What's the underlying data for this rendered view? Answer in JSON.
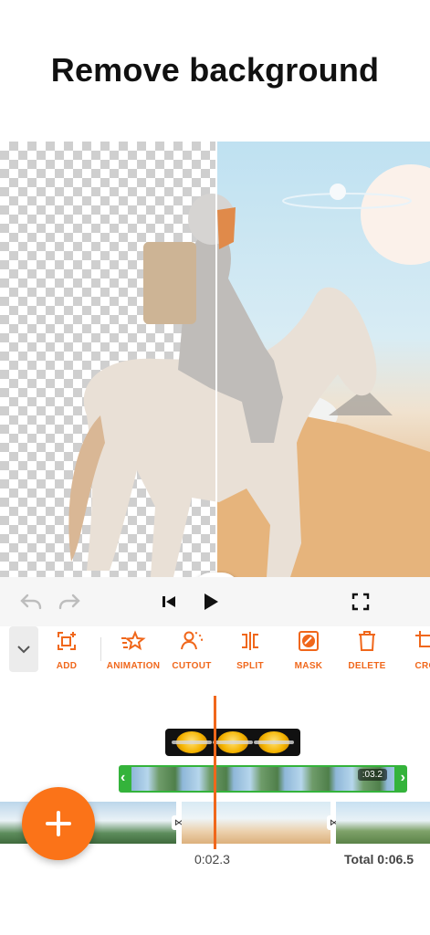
{
  "headline": "Remove background",
  "colors": {
    "accent": "#f0671b",
    "fab": "#fb7318",
    "overlay_track": "#34b33b"
  },
  "preview": {
    "handle_icon": "split-drag-icon",
    "cutout_button_icon": "person-cutout-icon"
  },
  "controls": {
    "undo_icon": "undo-icon",
    "redo_icon": "redo-icon",
    "skip_start_icon": "skip-to-start-icon",
    "play_icon": "play-icon",
    "fullscreen_icon": "fullscreen-icon"
  },
  "toolbar": {
    "collapse_icon": "chevron-down-icon",
    "items": [
      {
        "label": "ADD",
        "icon": "add-layer-icon"
      },
      {
        "label": "ANIMATION",
        "icon": "animation-star-icon"
      },
      {
        "label": "CUTOUT",
        "icon": "cutout-icon"
      },
      {
        "label": "SPLIT",
        "icon": "split-icon"
      },
      {
        "label": "MASK",
        "icon": "mask-icon"
      },
      {
        "label": "DELETE",
        "icon": "trash-icon"
      },
      {
        "label": "CRO",
        "icon": "crop-icon"
      }
    ]
  },
  "timeline": {
    "overlay_duration": ":03.2",
    "current_time": "0:02.3",
    "total_time": "Total 0:06.5",
    "transition_symbol": "⋈",
    "add_icon": "plus-icon"
  }
}
